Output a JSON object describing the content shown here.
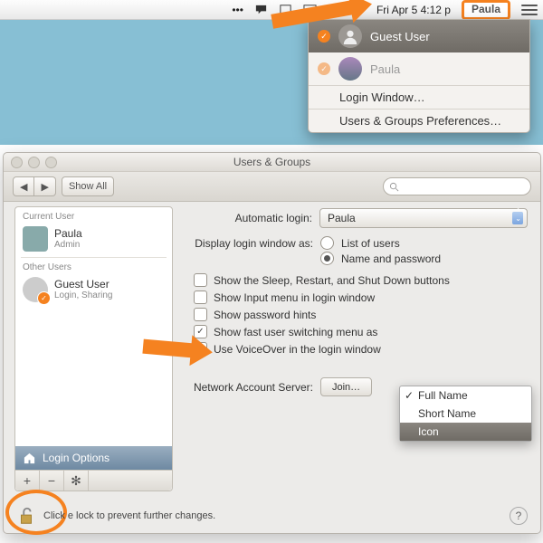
{
  "menubar": {
    "datetime": "Fri Apr 5  4:12 p",
    "username": "Paula"
  },
  "dropdown": {
    "guest": "Guest User",
    "paula": "Paula",
    "login_window": "Login Window…",
    "prefs": "Users & Groups Preferences…"
  },
  "window": {
    "title": "Users & Groups",
    "show_all": "Show All",
    "back": "◀",
    "forward": "▶",
    "search_placeholder": ""
  },
  "sidebar": {
    "current_head": "Current User",
    "current_name": "Paula",
    "current_sub": "Admin",
    "other_head": "Other Users",
    "guest_name": "Guest User",
    "guest_sub": "Login, Sharing",
    "login_options": "Login Options",
    "plus": "+",
    "minus": "−",
    "gear": "✻"
  },
  "pane": {
    "auto_login_label": "Automatic login:",
    "auto_login_value": "Paula",
    "display_label": "Display login window as:",
    "radio_list": "List of users",
    "radio_name": "Name and password",
    "chk_sleep": "Show the Sleep, Restart, and Shut Down buttons",
    "chk_input": "Show Input menu in login window",
    "chk_hints": "Show password hints",
    "chk_fast": "Show fast user switching menu as",
    "chk_voice": "Use VoiceOver in the login window",
    "net_label": "Network Account Server:",
    "join": "Join…"
  },
  "popup": {
    "full": "Full Name",
    "short": "Short Name",
    "icon": "Icon"
  },
  "footer": {
    "text": "Click the lock to prevent further changes.",
    "partial": "Click      e lock to prevent further changes."
  }
}
